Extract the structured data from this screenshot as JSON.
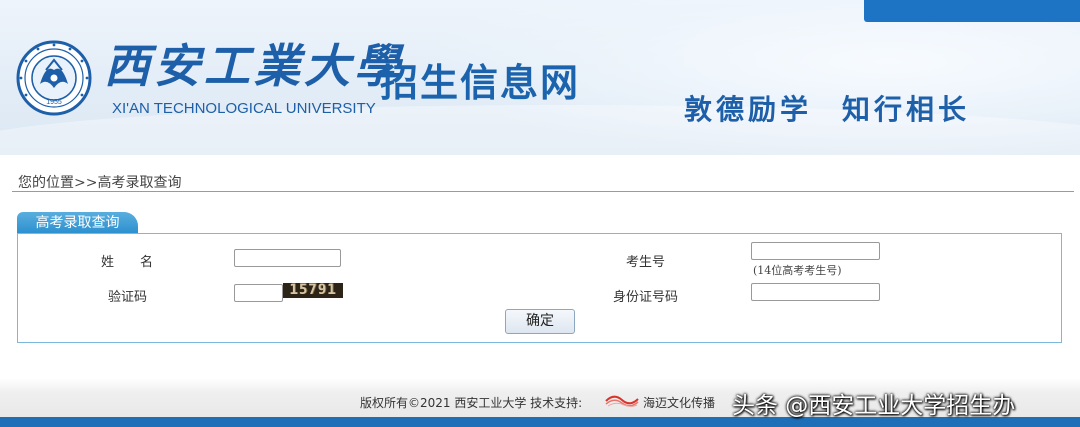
{
  "header": {
    "university_cn": "西安工業大學",
    "university_en": "XI'AN TECHNOLOGICAL UNIVERSITY",
    "site_title": "招生信息网",
    "motto_1": "敦德励学",
    "motto_2": "知行相长",
    "emblem_year": "1955",
    "accent_color": "#1e74c4"
  },
  "breadcrumb": {
    "text": "您的位置>>高考录取查询"
  },
  "query_form": {
    "tab_label": "高考录取查询",
    "name_label": "姓　　名",
    "name_value": "",
    "exam_no_label": "考生号",
    "exam_no_value": "",
    "exam_no_hint": "(14位高考考生号)",
    "captcha_label": "验证码",
    "captcha_value": "",
    "captcha_code": "15791",
    "id_label": "身份证号码",
    "id_value": "",
    "submit_label": "确定"
  },
  "footer": {
    "copyright": "版权所有©2021 西安工业大学 技术支持:",
    "sponsor": "海迈文化传播",
    "watermark": "头条 @西安工业大学招生办"
  }
}
